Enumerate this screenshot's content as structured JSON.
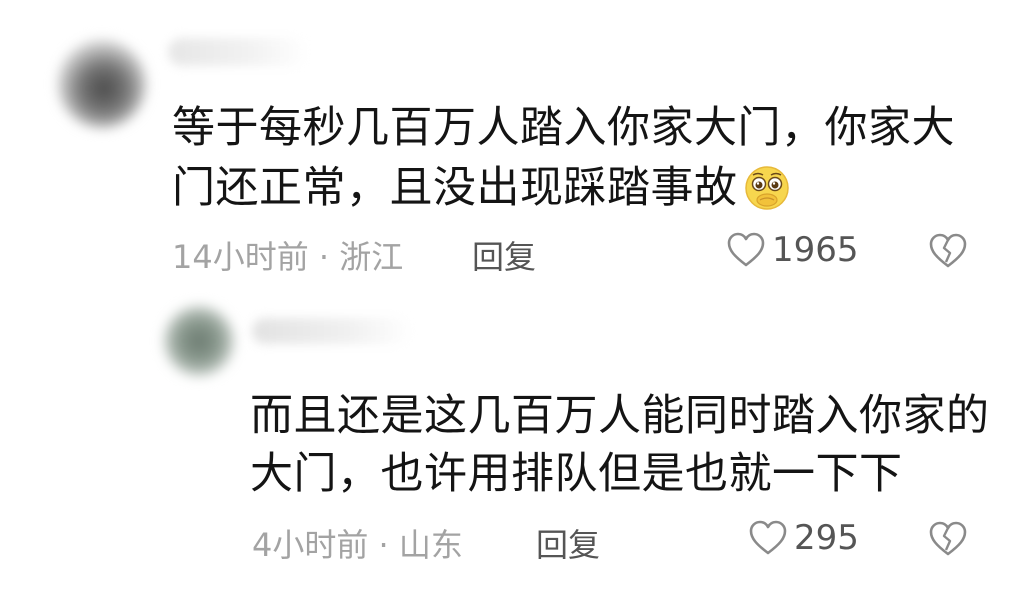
{
  "comments": [
    {
      "line1": "等于每秒几百万人踏入你家大门，你家大",
      "line2": "门还正常，且没出现踩踏事故",
      "emoji": "pleading-face-emoji",
      "meta": "14小时前 · 浙江",
      "reply_label": "回复",
      "likes": "1965"
    },
    {
      "line1": "而且还是这几百万人能同时踏入你家的",
      "line2": "大门，也许用排队但是也就一下下",
      "meta": "4小时前 · 山东",
      "reply_label": "回复",
      "likes": "295"
    }
  ],
  "colors": {
    "text": "#141414",
    "meta": "#a3a3a3",
    "icon": "#8a8a8a"
  },
  "icons": [
    "heart-outline-icon",
    "broken-heart-icon"
  ]
}
